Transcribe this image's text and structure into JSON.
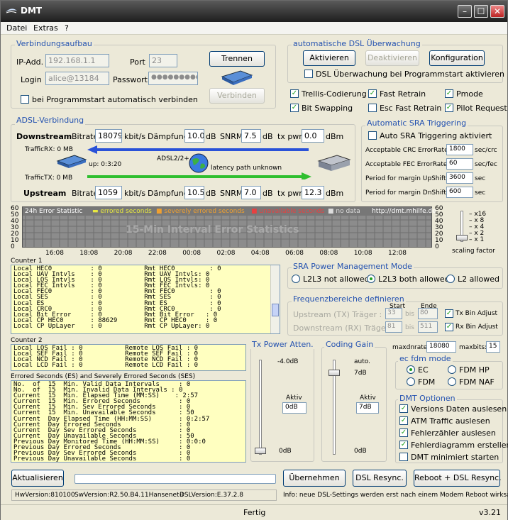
{
  "window": {
    "title": "DMT"
  },
  "menu": {
    "items": [
      "Datei",
      "Extras",
      "?"
    ]
  },
  "connection": {
    "title": "Verbindungsaufbau",
    "ip_label": "IP-Add.",
    "ip_value": "192.168.1.1",
    "port_label": "Port",
    "port_value": "23",
    "login_label": "Login",
    "login_value": "alice@13184",
    "password_label": "Passwort",
    "password_value": "●●●●●●●●●",
    "disconnect_button": "Trennen",
    "connect_button": "Verbinden",
    "autoconnect_label": "bei Programmstart automatisch verbinden"
  },
  "dsl_watch": {
    "title": "automatische DSL Überwachung",
    "activate_button": "Aktivieren",
    "deactivate_button": "Deaktivieren",
    "config_button": "Konfiguration",
    "watch_on_start_label": "DSL Überwachung bei Programmstart aktivieren"
  },
  "options": {
    "trellis": "Trellis-Codierung",
    "fast_retrain": "Fast Retrain",
    "pmode": "Pmode",
    "bit_swapping": "Bit Swapping",
    "esc_fast_retrain": "Esc Fast Retrain",
    "pilot_request": "Pilot Request"
  },
  "adsl": {
    "title": "ADSL-Verbindung",
    "downstream_label": "Downstream",
    "upstream_label": "Upstream",
    "bitrate_label": "Bitrate",
    "kbits": "kbit/s",
    "attenuation_label": "Dämpfung",
    "db": "dB",
    "snrm_label": "SNRM",
    "txpwr_label": "tx pwr",
    "dbm": "dBm",
    "down_bitrate": "18079",
    "down_att": "10.0",
    "down_snrm": "7.5",
    "down_txpwr": "0.0",
    "up_bitrate": "1059",
    "up_att": "10.5",
    "up_snrm": "7.0",
    "up_txpwr": "12.3",
    "traffic_rx": "TrafficRX: 0 MB",
    "traffic_tx": "TrafficTX: 0 MB",
    "uptime": "up: 0:3:20",
    "mode": "ADSL2/2+",
    "latency": "latency path unknown"
  },
  "sra": {
    "title": "Automatic SRA Triggering",
    "auto_label": "Auto SRA Triggering aktiviert",
    "crc_label": "Acceptable CRC ErrorRate",
    "crc_value": "1800",
    "crc_unit": "sec/crc",
    "fec_label": "Acceptable FEC ErrorRate",
    "fec_value": "60",
    "fec_unit": "sec/fec",
    "up_label": "Period for margin UpShift",
    "up_value": "3600",
    "up_unit": "sec",
    "dn_label": "Period for margin DnShift",
    "dn_value": "600",
    "dn_unit": "sec"
  },
  "chart": {
    "y_ticks": [
      "60",
      "50",
      "40",
      "30",
      "20",
      "10",
      "0"
    ],
    "x_ticks": [
      "16:08",
      "18:08",
      "20:08",
      "22:08",
      "00:08",
      "02:08",
      "04:08",
      "06:08",
      "08:08",
      "10:08",
      "12:08"
    ],
    "legend_title": "24h Error Statistic",
    "legend_errored": "errored seconds",
    "legend_severe": "severely errored seconds",
    "legend_unavail": "unavailable seconds",
    "legend_nodata": "no data",
    "url": "http://dmt.mhilfe.de",
    "watermark": "15-Min Interval Error Statistics",
    "scale_labels": [
      "x16",
      "x 8",
      "x 4",
      "x 2",
      "x 1"
    ],
    "scale_factor_label": "scaling factor",
    "colors": {
      "errored": "#e8e840",
      "severe": "#f0a030",
      "unavail": "#e84040",
      "nodata": "#bbbbbb"
    }
  },
  "counter1": {
    "title": "Counter 1",
    "lines": [
      "Local HEC0          : 0           Rmt HEC0         : 0",
      "Local UAV Intvls    : 0           Rmt UAV Intvls: 0",
      "Local LOS Intvls    : 0           Rmt LOS Intvls: 0",
      "Local FEC Intvls    : 0           Rmt FEC Intvls: 0",
      "Local FEC0          : 0           Rmt FEC0         : 0",
      "Local SES           : 0           Rmt SES          : 0",
      "Local ES            : 0           Rmt ES           : 0",
      "Local CRC0          : 0           Rmt CRC0         : 0",
      "Local Bit Error     : 0           Rmt Bit Error   : 0",
      "Local CP HEC0       : 88629       Rmt CP HEC0     : 0",
      "Local CP UpLayer    : 0           Rmt CP UpLayer: 0"
    ]
  },
  "counter2": {
    "title": "Counter 2",
    "lines": [
      "Local LOS Fail : 0           Remote LOS Fail : 0",
      "Local SEF Fail : 0           Remote SEF Fail : 0",
      "Local NCD Fail : 0           Remote NCD Fail : 0",
      "Local LCD Fail : 0           Remote LCD Fail : 0"
    ]
  },
  "errored": {
    "title": "Errored Seconds (ES) and Severely Errored Seconds (SES)",
    "lines": [
      "No.  of  15  Min. Valid Data Intervals     : 0",
      "No.  of  15  Min. Invalid Data Intervals : 0",
      "Current  15  Min. Elapsed Time (MM:SS)    : 2:57",
      "Current  15  Min. Errored Seconds          : 0",
      "Current  15  Min. Sev Errored Seconds      : 0",
      "Current  15  Min. Unavailable Seconds      : 50",
      "Current  Day Elapsed Time (HH:MM:SS)       : 0:2:57",
      "Current  Day Errored Seconds               : 0",
      "Current  Day Sev Errored Seconds           : 0",
      "Current  Day Unavailable Seconds           : 50",
      "Previous Day Monitored Time (HH:MM:SS)     : 0:0:0",
      "Previous Day Errored Seconds               : 0",
      "Previous Day Sev Errored Seconds           : 0",
      "Previous Day Unavailable Seconds           : 0"
    ]
  },
  "power_mode": {
    "title": "SRA Power Management Mode",
    "l2l3_not": "L2L3 not allowed",
    "l2l3_both": "L2L3 both allowed",
    "l2": "L2 allowed"
  },
  "freq": {
    "title": "Frequenzbereiche definieren",
    "start_label": "Start",
    "end_label": "Ende",
    "up_label": "Upstream (TX) Träger :",
    "up_start": "33",
    "up_end": "80",
    "bis": "bis",
    "down_label": "Downstream (RX) Träger :",
    "down_start": "81",
    "down_end": "511",
    "tx_bin": "Tx Bin Adjust",
    "rx_bin": "Rx Bin Adjust"
  },
  "tx_atten": {
    "title": "Tx Power Atten.",
    "top": "-4.0dB",
    "bottom": "0dB",
    "aktiv_label": "Aktiv",
    "aktiv_value": "0dB"
  },
  "coding_gain": {
    "title": "Coding Gain",
    "auto": "auto.",
    "top": "7dB",
    "bottom": "0dB",
    "aktiv_label": "Aktiv",
    "aktiv_value": "7dB"
  },
  "maxrate": {
    "maxdnrate_label": "maxdnrate:",
    "maxdnrate_value": "18080",
    "maxbits_label": "maxbits:",
    "maxbits_value": "15"
  },
  "ec_fdm": {
    "title": "ec fdm mode",
    "ec": "EC",
    "fdm_hp": "FDM HP",
    "fdm": "FDM",
    "fdm_naf": "FDM NAF"
  },
  "dmt_options": {
    "title": "DMT Optionen",
    "versions": "Versions Daten auslesen",
    "atm": "ATM Traffic auslesen",
    "errors": "Fehlerzähler auslesen",
    "diagram": "Fehlerdiagramm erstellen",
    "minimized": "DMT minimiert starten"
  },
  "bottom": {
    "refresh": "Aktualisieren",
    "apply": "Übernehmen",
    "resync": "DSL Resync.",
    "reboot": "Reboot + DSL Resync.",
    "hw_version": "HwVersion:810100",
    "sw_version": "SwVersion:R2.50.B4.11Hansenet-I",
    "dsl_version": "DSLVersion:E.37.2.8",
    "info": "Info: neue DSL-Settings werden erst nach einem Modem Reboot wirksam"
  },
  "status": {
    "text": "Fertig",
    "version": "v3.21"
  }
}
